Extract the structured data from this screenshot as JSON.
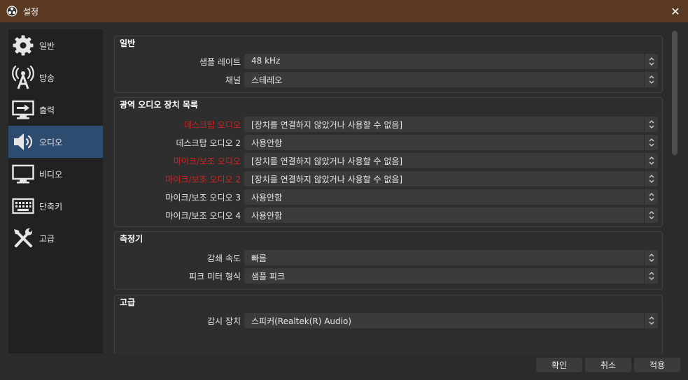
{
  "window": {
    "title": "설정",
    "close_glyph": "✕"
  },
  "sidebar": {
    "items": [
      {
        "label": "일반",
        "icon": "gear-icon"
      },
      {
        "label": "방송",
        "icon": "broadcast-tower-icon"
      },
      {
        "label": "출력",
        "icon": "output-monitor-icon"
      },
      {
        "label": "오디오",
        "icon": "speaker-icon",
        "active": true
      },
      {
        "label": "비디오",
        "icon": "monitor-icon"
      },
      {
        "label": "단축키",
        "icon": "keyboard-icon"
      },
      {
        "label": "고급",
        "icon": "tools-icon"
      }
    ]
  },
  "groups": {
    "general": {
      "title": "일반",
      "rows": [
        {
          "label": "샘플 레이트",
          "value": "48 kHz"
        },
        {
          "label": "채널",
          "value": "스테레오"
        }
      ]
    },
    "devices": {
      "title": "광역 오디오 장치 목록",
      "rows": [
        {
          "label": "데스크탑 오디오",
          "value": "[장치를 연결하지 않았거나 사용할 수 없음]",
          "error": true
        },
        {
          "label": "데스크탑 오디오 2",
          "value": "사용안함"
        },
        {
          "label": "마이크/보조 오디오",
          "value": "[장치를 연결하지 않았거나 사용할 수 없음]",
          "error": true
        },
        {
          "label": "마이크/보조 오디오 2",
          "value": "[장치를 연결하지 않았거나 사용할 수 없음]",
          "error": true
        },
        {
          "label": "마이크/보조 오디오 3",
          "value": "사용안함"
        },
        {
          "label": "마이크/보조 오디오 4",
          "value": "사용안함"
        }
      ]
    },
    "meters": {
      "title": "측정기",
      "rows": [
        {
          "label": "감쇄 속도",
          "value": "빠름"
        },
        {
          "label": "피크 미터 형식",
          "value": "샘플 피크"
        }
      ]
    },
    "advanced": {
      "title": "고급",
      "rows": [
        {
          "label": "감시 장치",
          "value": "스피커(Realtek(R) Audio)"
        }
      ]
    }
  },
  "buttons": {
    "ok": "확인",
    "cancel": "취소",
    "apply": "적용"
  },
  "colors": {
    "titlebar": "#5a3a22",
    "active_item": "#2d4c70",
    "error_label": "#cf2424"
  }
}
